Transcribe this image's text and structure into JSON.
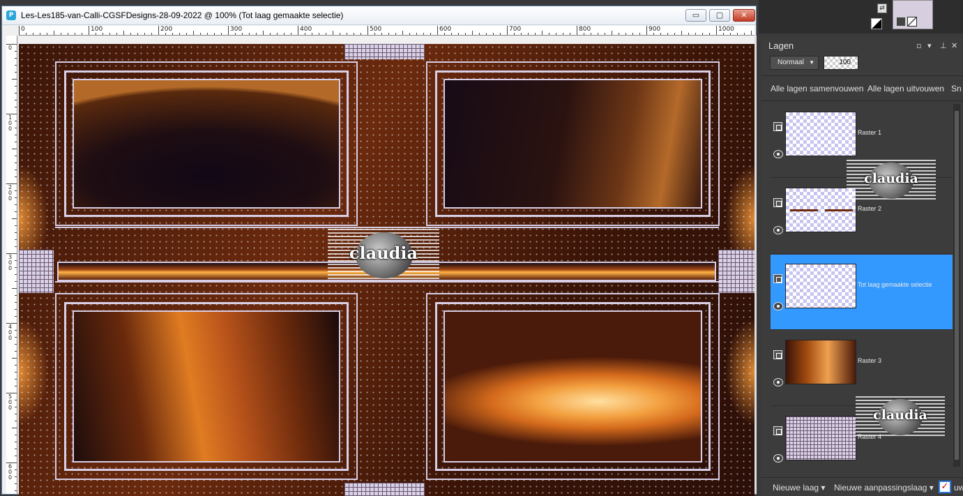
{
  "document": {
    "title": "Les-Les185-van-Calli-CGSFDesigns-28-09-2022 @ 100% (Tot laag gemaakte selectie)",
    "app_icon": "psp-app-icon",
    "buttons": {
      "minimize": "▭",
      "maximize": "▢",
      "close": "✕"
    },
    "ruler_top_labels": [
      "0",
      "100",
      "200",
      "300",
      "400",
      "500",
      "600",
      "700",
      "800",
      "900",
      "1000"
    ],
    "ruler_left_labels": [
      "0",
      "100",
      "200",
      "300",
      "400",
      "500",
      "600"
    ],
    "watermark_text": "claudia"
  },
  "colors": {
    "accent_selected": "#3399ff",
    "panel_bg": "#3c3c3c",
    "frame_line": "#d8cfe6"
  },
  "layers_panel": {
    "title": "Lagen",
    "blend_mode": "Normaal",
    "opacity": "100",
    "actions": [
      "Alle lagen samenvouwen",
      "Alle lagen uitvouwen",
      "Sn"
    ],
    "layers": [
      {
        "name": "Raster 1",
        "selected": false
      },
      {
        "name": "Raster 2",
        "selected": false
      },
      {
        "name": "Tot laag gemaakte selectie",
        "selected": true
      },
      {
        "name": "Raster 3",
        "selected": false
      },
      {
        "name": "Raster 4",
        "selected": false
      }
    ],
    "bottom": {
      "new_layer": "Nieuwe laag",
      "new_adjustment": "Nieuwe aanpassingslaag",
      "trailing": "uw"
    },
    "watermark_text": "claudia"
  }
}
